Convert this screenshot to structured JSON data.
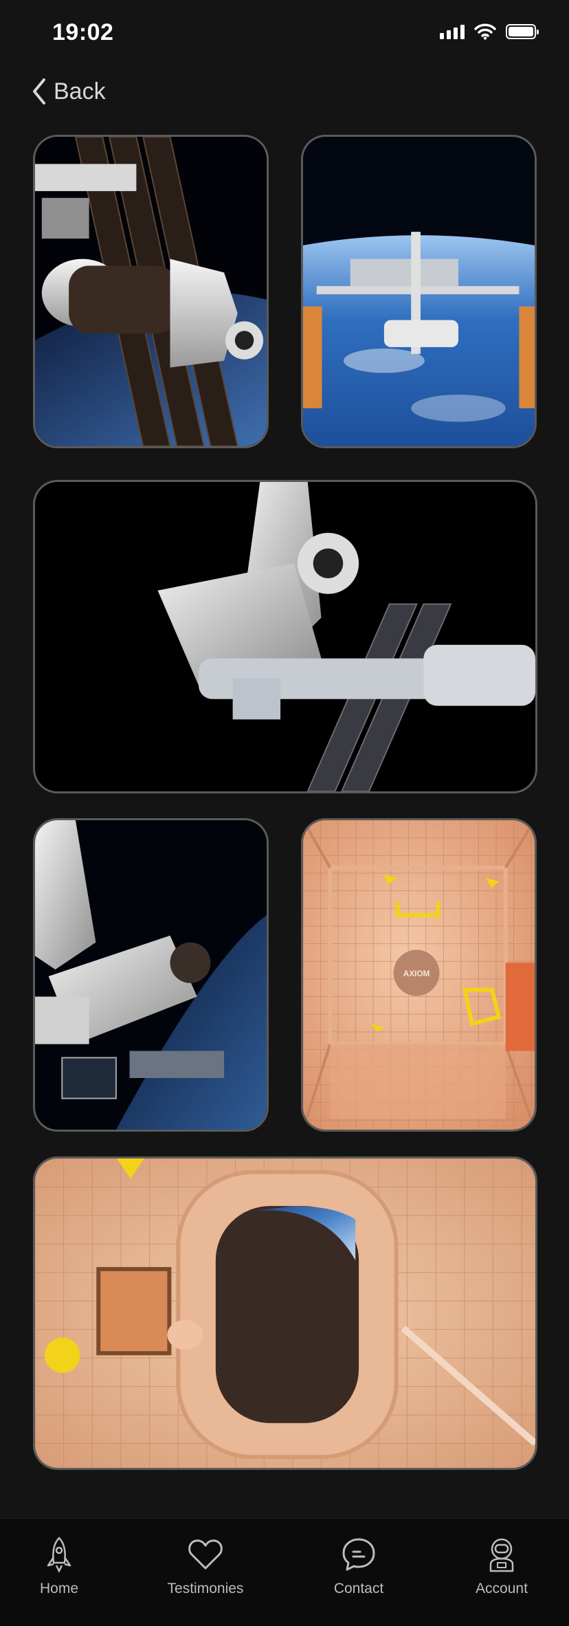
{
  "status_bar": {
    "time": "19:02",
    "icons": [
      "cellular-signal-icon",
      "wifi-icon",
      "battery-icon"
    ]
  },
  "navigation": {
    "back_label": "Back",
    "back_icon": "chevron-left-icon"
  },
  "gallery": {
    "items": [
      {
        "name": "station-module-earth-view"
      },
      {
        "name": "space-station-over-ocean"
      },
      {
        "name": "station-docking-black-space"
      },
      {
        "name": "station-modules-over-earth"
      },
      {
        "name": "padded-module-interior",
        "logo_text": "AXIOM"
      },
      {
        "name": "module-interior-with-window"
      }
    ]
  },
  "tab_bar": {
    "tabs": [
      {
        "label": "Home",
        "icon": "rocket-icon"
      },
      {
        "label": "Testimonies",
        "icon": "heart-icon"
      },
      {
        "label": "Contact",
        "icon": "chat-bubble-icon"
      },
      {
        "label": "Account",
        "icon": "astronaut-icon"
      }
    ]
  },
  "colors": {
    "background": "#141414",
    "card_border": "#5a5a5a",
    "tab_bar": "#0b0b0b",
    "tab_label": "#bdbdbd"
  }
}
